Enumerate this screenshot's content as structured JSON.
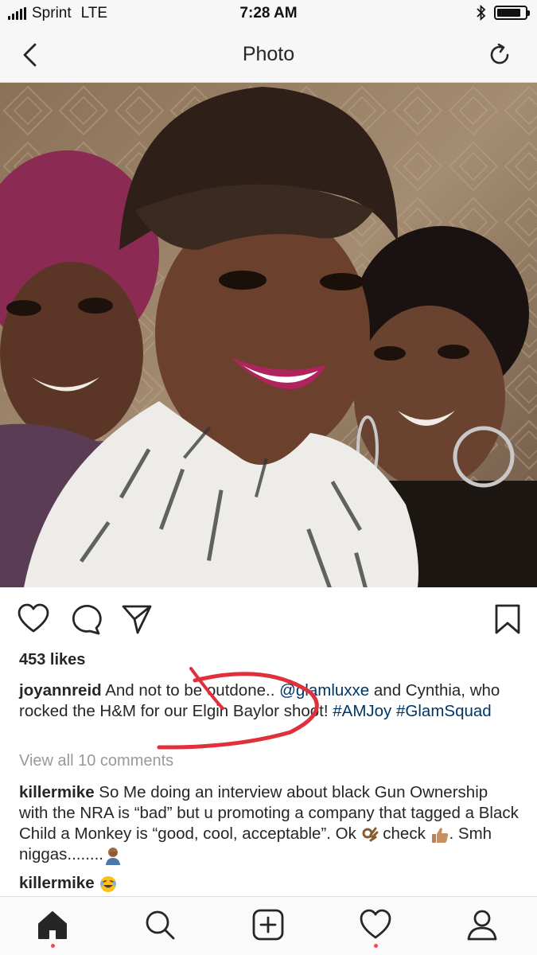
{
  "status_bar": {
    "carrier": "Sprint",
    "network": "LTE",
    "time": "7:28 AM"
  },
  "nav": {
    "title": "Photo",
    "back_icon": "chevron-left-icon",
    "refresh_icon": "refresh-icon"
  },
  "post": {
    "likes": "453 likes",
    "caption": {
      "user": "joyannreid",
      "text1": " And not to be outdone.. ",
      "mention": "@glamluxxe",
      "text2": " and Cynthia, who rocked the H&M for our Elgin Baylor shoot! ",
      "tag1": "#AMJoy",
      "tag2": "#GlamSquad"
    },
    "view_all": "View all 10 comments",
    "comments": [
      {
        "user": "killermike",
        "text1": " So Me doing an interview about black Gun Ownership with the NRA is “bad” but u promoting a company that tagged a Black Child a Monkey is “good, cool, acceptable”.  Ok ",
        "text2": " check ",
        "text3": ". Smh niggas........"
      },
      {
        "user": "killermike"
      }
    ]
  },
  "colors": {
    "accent_link": "#003569",
    "annotation": "#e0303c",
    "notification_dot": "#ed4956"
  }
}
